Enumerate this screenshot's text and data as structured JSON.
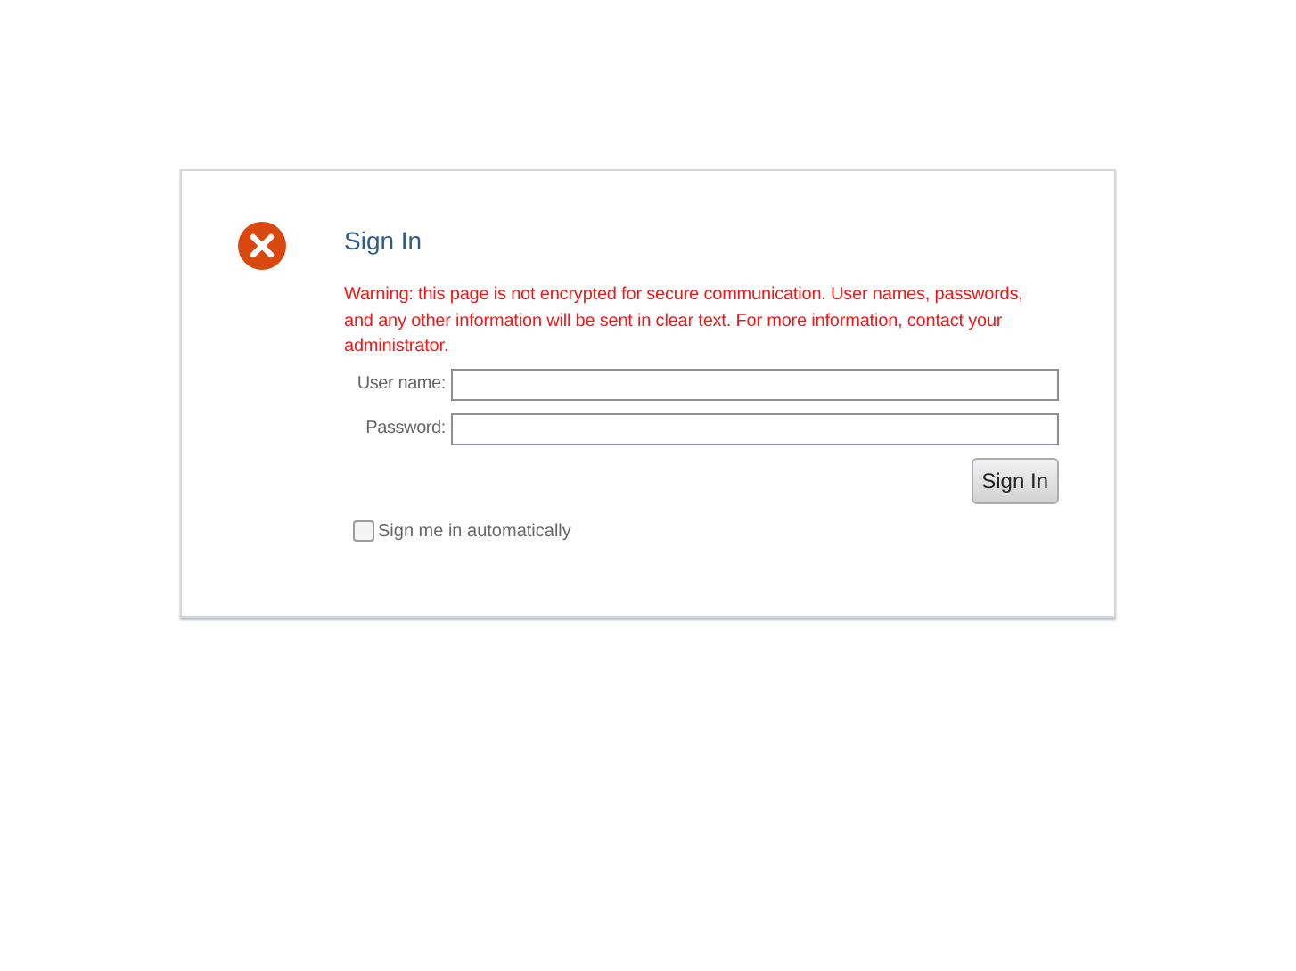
{
  "dialog": {
    "title": "Sign In",
    "warning": "Warning: this page is not encrypted for secure communication. User names, passwords, and any other information will be sent in clear text. For more information, contact your administrator.",
    "fields": [
      {
        "label": "User name:"
      },
      {
        "label": "Password:"
      }
    ],
    "submit": "Sign In",
    "remember": {
      "label": "Sign me in automatically",
      "checked": false
    }
  }
}
